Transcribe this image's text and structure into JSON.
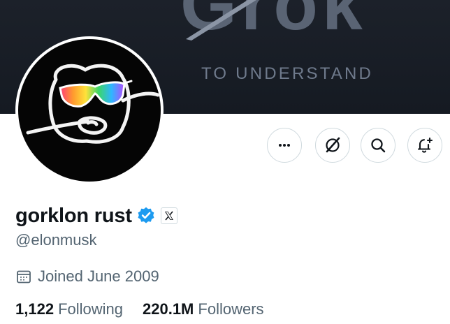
{
  "banner": {
    "wordmark": "Grok",
    "tagline": "TO UNDERSTAND",
    "bg_color": "#181d25"
  },
  "profile": {
    "display_name": "gorklon rust",
    "handle": "@elonmusk",
    "verified_color": "#1d9bf0",
    "joined": "Joined June 2009",
    "affiliation_icon": "x-logo-icon",
    "avatar_icon": "doodle-face-with-rainbow-sunglasses"
  },
  "actions": [
    {
      "name": "more-button",
      "icon": "more-dots-icon"
    },
    {
      "name": "grok-button",
      "icon": "grok-icon"
    },
    {
      "name": "search-button",
      "icon": "search-icon"
    },
    {
      "name": "notify-button",
      "icon": "bell-plus-icon"
    }
  ],
  "stats": {
    "following_count": "1,122",
    "following_label": "Following",
    "followers_count": "220.1M",
    "followers_label": "Followers"
  }
}
